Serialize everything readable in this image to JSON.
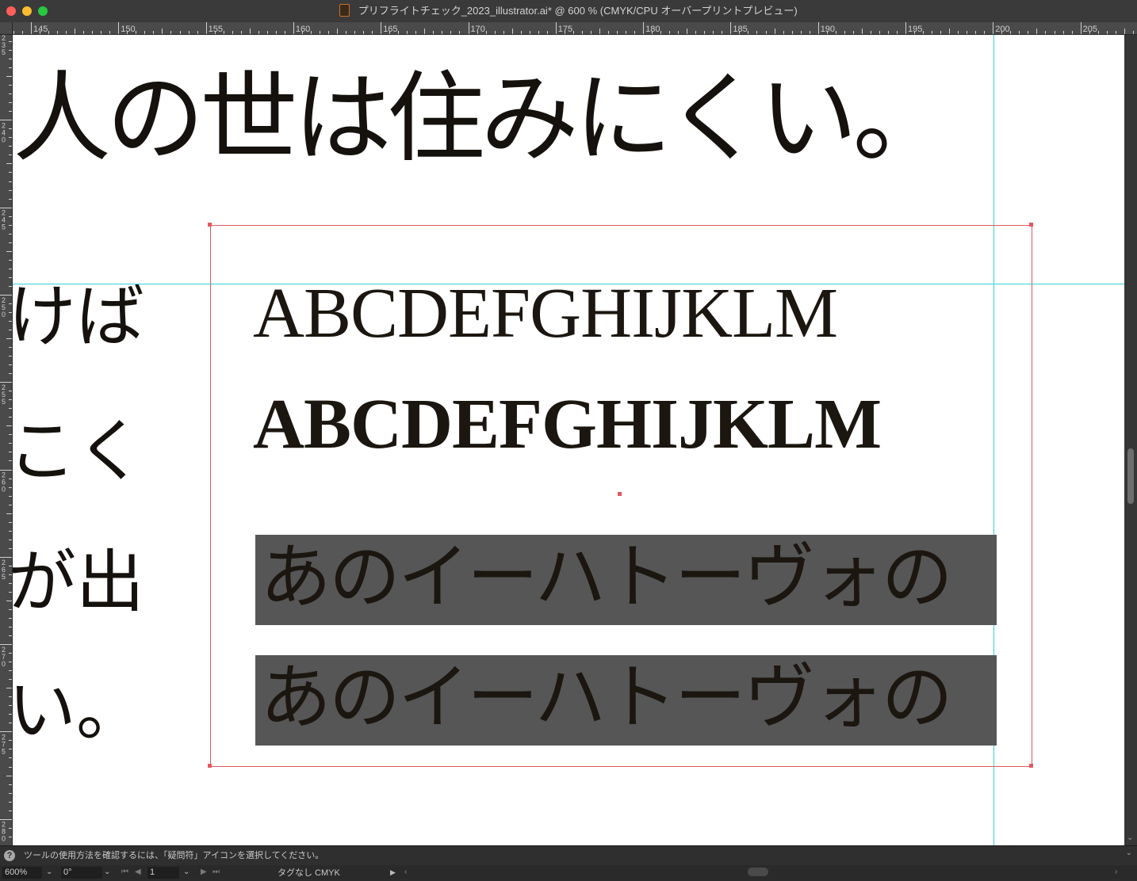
{
  "window": {
    "title": "プリフライトチェック_2023_illustrator.ai* @ 600 % (CMYK/CPU オーバープリントプレビュー)",
    "app_icon": "illustrator-doc-icon"
  },
  "rulers": {
    "top_labels": [
      "145",
      "150",
      "155",
      "160",
      "165",
      "170",
      "175",
      "180",
      "185",
      "190",
      "195",
      "200",
      "205"
    ],
    "left_labels": [
      "235",
      "240",
      "245",
      "250",
      "255",
      "260",
      "265",
      "270",
      "275",
      "280"
    ]
  },
  "canvas": {
    "big_line": "人の世は住みにくい。",
    "left_column": [
      "けば",
      "こく",
      "が出",
      "い。"
    ],
    "latin_regular": "ABCDEFGHIJKLM",
    "latin_bold": "ABCDEFGHIJKLM",
    "kana_line_1": "あのイーハトーヴォの",
    "kana_line_2": "あのイーハトーヴォの"
  },
  "colors": {
    "selection": "#e0595d",
    "guide": "#35d3d8",
    "text_band": "#565656"
  },
  "status": {
    "help_icon": "?",
    "help_text": "ツールの使用方法を確認するには、「疑問符」アイコンを選択してください。"
  },
  "bottom_bar": {
    "zoom": "600%",
    "rotation": "0°",
    "artboard": "1",
    "profile": "タグなし CMYK"
  }
}
